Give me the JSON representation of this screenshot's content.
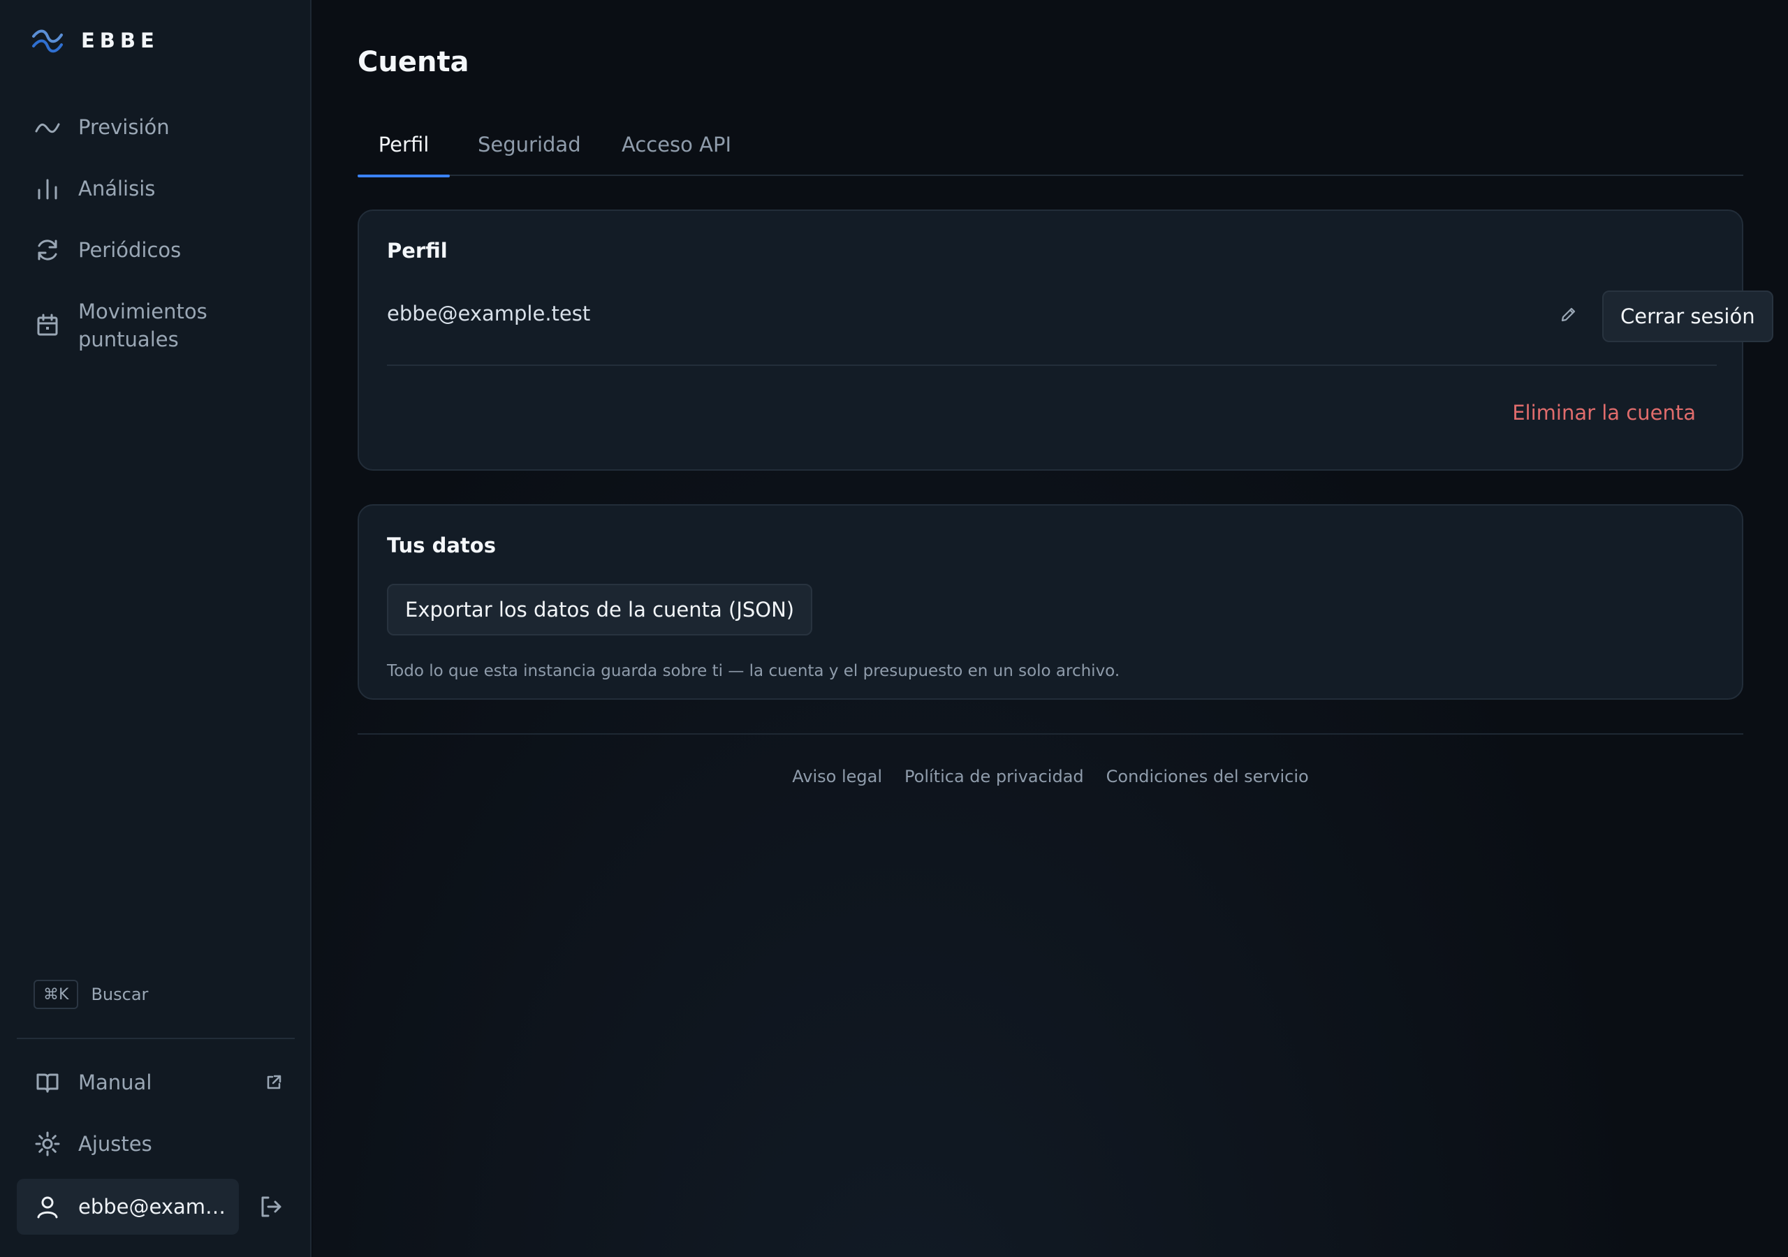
{
  "app": {
    "brand": "EBBE",
    "accent": "#3b82f6",
    "danger": "#e06c6c"
  },
  "sidebar": {
    "nav": [
      {
        "label": "Previsión",
        "icon": "trend-line-icon"
      },
      {
        "label": "Análisis",
        "icon": "bar-chart-icon"
      },
      {
        "label": "Periódicos",
        "icon": "refresh-icon"
      },
      {
        "label": "Movimientos puntuales",
        "icon": "calendar-icon"
      }
    ],
    "search": {
      "shortcut": "⌘K",
      "label": "Buscar"
    },
    "bottom": [
      {
        "label": "Manual",
        "icon": "book-icon",
        "trailing_icon": "external-link-icon"
      },
      {
        "label": "Ajustes",
        "icon": "sun-icon"
      }
    ],
    "user": {
      "label": "ebbe@examp...",
      "icon": "user-icon",
      "action_icon": "logout-icon"
    }
  },
  "main": {
    "title": "Cuenta",
    "tabs": [
      {
        "label": "Perfil",
        "active": true
      },
      {
        "label": "Seguridad",
        "active": false
      },
      {
        "label": "Acceso API",
        "active": false
      }
    ],
    "profile_card": {
      "title": "Perfil",
      "email": "ebbe@example.test",
      "logout_button": "Cerrar sesión",
      "delete_link": "Eliminar la cuenta"
    },
    "data_card": {
      "title": "Tus datos",
      "export_button": "Exportar los datos de la cuenta (JSON)",
      "help": "Todo lo que esta instancia guarda sobre ti — la cuenta y el presupuesto en un solo archivo."
    },
    "footer": {
      "legal": "Aviso legal",
      "privacy": "Política de privacidad",
      "terms": "Condiciones del servicio"
    }
  }
}
